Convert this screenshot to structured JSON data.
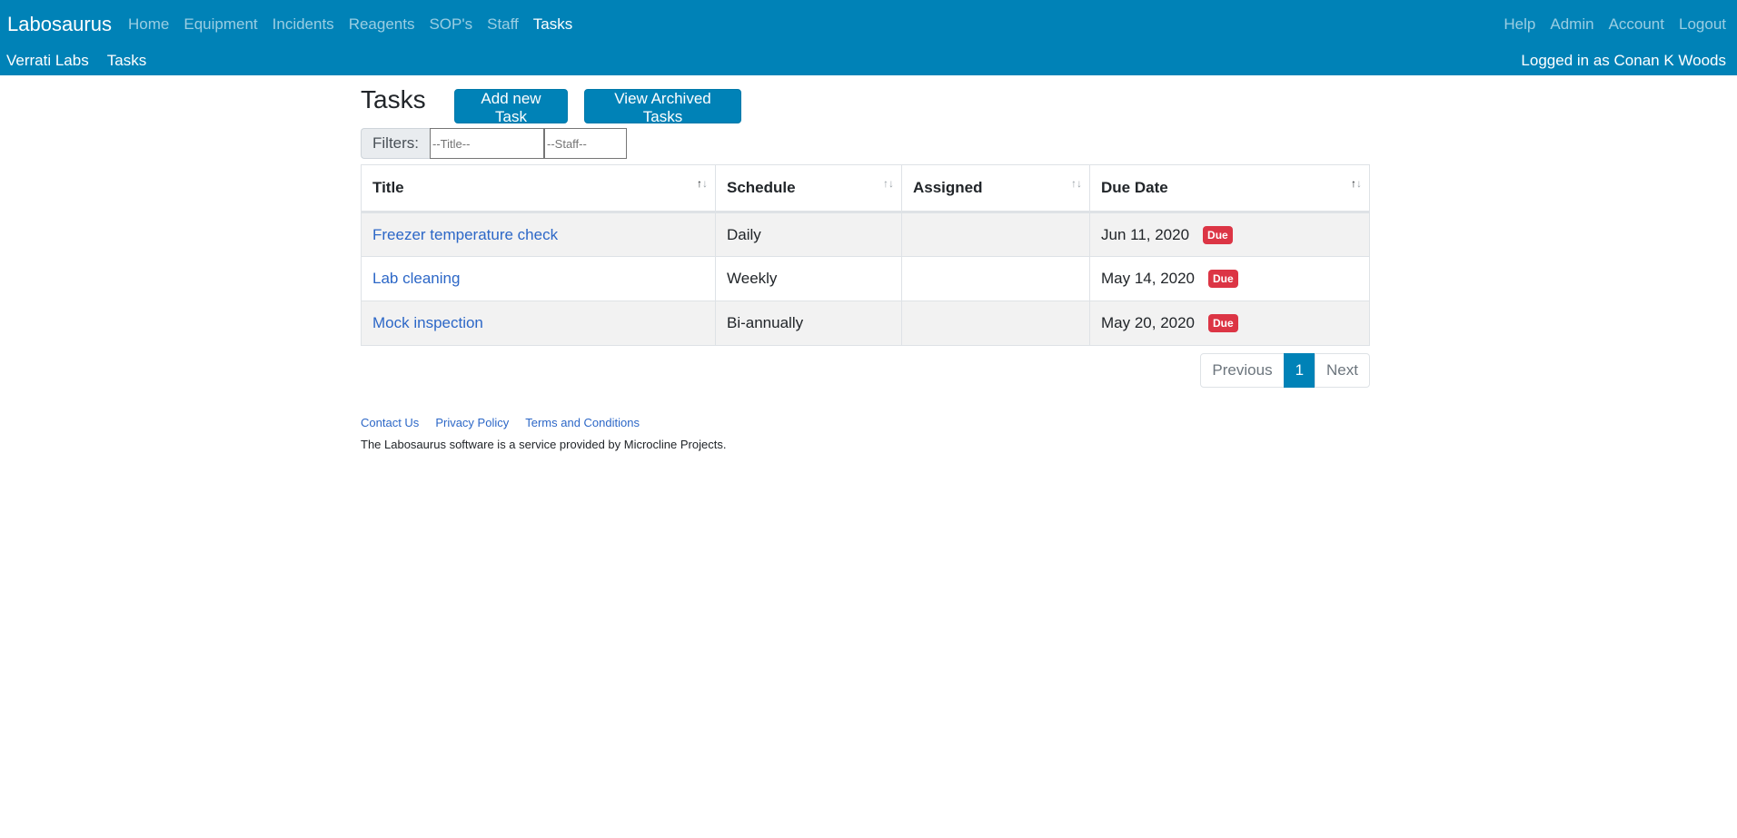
{
  "navbar": {
    "brand": "Labosaurus",
    "main_items": [
      {
        "label": "Home"
      },
      {
        "label": "Equipment"
      },
      {
        "label": "Incidents"
      },
      {
        "label": "Reagents"
      },
      {
        "label": "SOP's"
      },
      {
        "label": "Staff"
      },
      {
        "label": "Tasks",
        "active": true
      }
    ],
    "right_items": [
      {
        "label": "Help"
      },
      {
        "label": "Admin"
      },
      {
        "label": "Account"
      },
      {
        "label": "Logout"
      }
    ],
    "sub_items": [
      {
        "label": "Verrati Labs"
      },
      {
        "label": "Tasks"
      }
    ],
    "logged_in": "Logged in as Conan K Woods"
  },
  "page": {
    "title": "Tasks",
    "add_button": "Add new Task",
    "archived_button": "View Archived Tasks"
  },
  "filters": {
    "label": "Filters:",
    "title_placeholder": "--Title--",
    "staff_placeholder": "--Staff--"
  },
  "table": {
    "headers": {
      "title": "Title",
      "schedule": "Schedule",
      "assigned": "Assigned",
      "due_date": "Due Date"
    },
    "sort_glyphs": {
      "up": "↑",
      "down": "↓"
    },
    "rows": [
      {
        "title": "Freezer temperature check",
        "schedule": "Daily",
        "assigned": "",
        "due_date": "Jun 11, 2020",
        "status": "Due"
      },
      {
        "title": "Lab cleaning",
        "schedule": "Weekly",
        "assigned": "",
        "due_date": "May 14, 2020",
        "status": "Due"
      },
      {
        "title": "Mock inspection",
        "schedule": "Bi-annually",
        "assigned": "",
        "due_date": "May 20, 2020",
        "status": "Due"
      }
    ]
  },
  "pagination": {
    "previous": "Previous",
    "current": "1",
    "next": "Next"
  },
  "footer": {
    "links": [
      {
        "label": "Contact Us"
      },
      {
        "label": "Privacy Policy"
      },
      {
        "label": "Terms and Conditions"
      }
    ],
    "note": "The Labosaurus software is a service provided by Microcline Projects."
  },
  "colors": {
    "primary": "#0082b7",
    "link": "#2c67c7",
    "badge_danger": "#dc3545",
    "stripe": "#f2f2f2"
  }
}
